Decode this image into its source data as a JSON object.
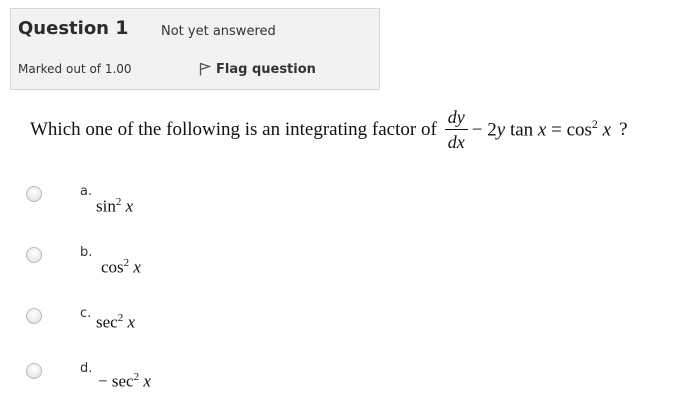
{
  "info": {
    "question_label": "Question",
    "question_number": "1",
    "status": "Not yet answered",
    "marks": "Marked out of 1.00",
    "flag_label": "Flag question"
  },
  "question": {
    "prefix": "Which one of the following is an integrating factor of",
    "frac_num": "dy",
    "frac_den": "dx",
    "rest_a": "− 2",
    "rest_y": "y",
    "rest_tan": " tan ",
    "rest_x1": "x",
    "rest_eq": " = cos",
    "rest_exp": "2",
    "rest_x2": "x",
    "suffix": "?"
  },
  "options": [
    {
      "letter": "a.",
      "func": "sin",
      "exp": "2",
      "var": "x",
      "sign": ""
    },
    {
      "letter": "b.",
      "func": "cos",
      "exp": "2",
      "var": "x",
      "sign": ""
    },
    {
      "letter": "c.",
      "func": "sec",
      "exp": "2",
      "var": "x",
      "sign": ""
    },
    {
      "letter": "d.",
      "func": "sec",
      "exp": "2",
      "var": "x",
      "sign": "−"
    }
  ]
}
